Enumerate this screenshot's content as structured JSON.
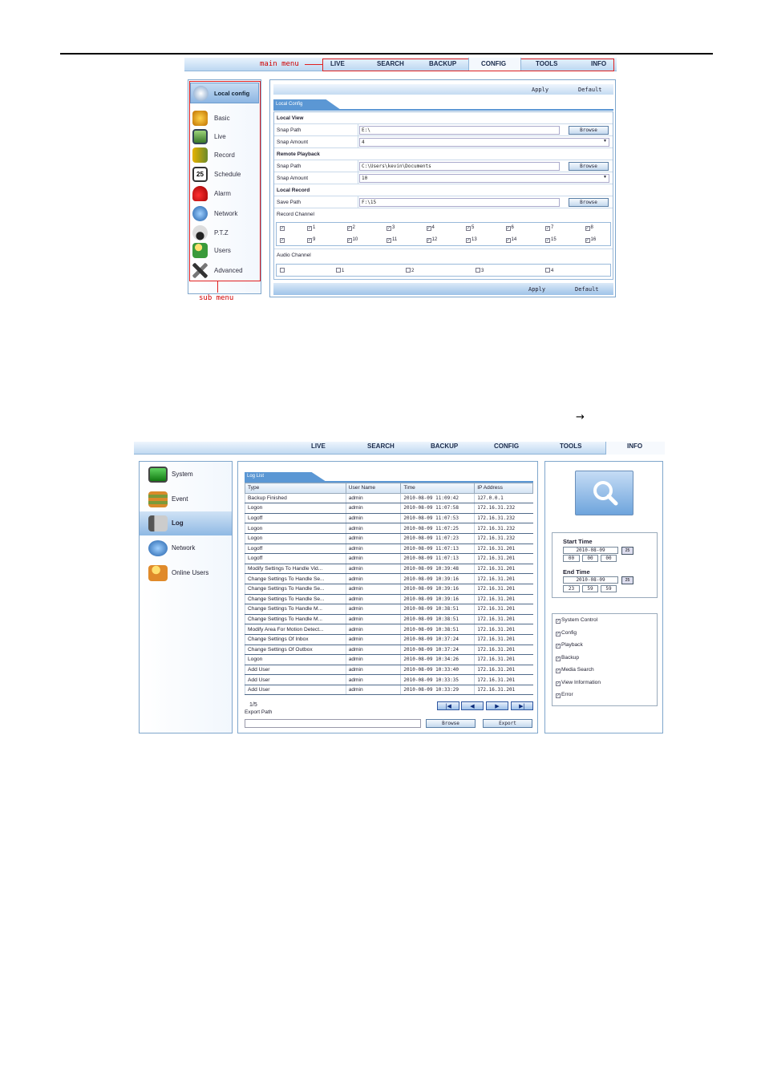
{
  "shot1": {
    "annotations": {
      "main_menu": "main menu",
      "sub_menu": "sub menu"
    },
    "menu": [
      "LIVE",
      "SEARCH",
      "BACKUP",
      "CONFIG",
      "TOOLS",
      "INFO"
    ],
    "sidebar": {
      "header": "Local config",
      "items": [
        {
          "label": "Basic",
          "icon": "basic-icon"
        },
        {
          "label": "Live",
          "icon": "live-icon"
        },
        {
          "label": "Record",
          "icon": "record-icon"
        },
        {
          "label": "Schedule",
          "icon": "schedule-icon"
        },
        {
          "label": "Alarm",
          "icon": "alarm-icon"
        },
        {
          "label": "Network",
          "icon": "network-icon"
        },
        {
          "label": "P.T.Z",
          "icon": "ptz-icon"
        },
        {
          "label": "Users",
          "icon": "users-icon"
        },
        {
          "label": "Advanced",
          "icon": "advanced-icon"
        }
      ]
    },
    "schedule_day": "25",
    "apply": "Apply",
    "default": "Default",
    "tab": "Local Config",
    "local_view": {
      "title": "Local View",
      "snap_path_label": "Snap Path",
      "snap_path": "E:\\",
      "snap_amount_label": "Snap Amount",
      "snap_amount": "4"
    },
    "remote_playback": {
      "title": "Remote Playback",
      "snap_path_label": "Snap Path",
      "snap_path": "C:\\Users\\kevin\\Documents",
      "snap_amount_label": "Snap Amount",
      "snap_amount": "10"
    },
    "local_record": {
      "title": "Local Record",
      "save_path_label": "Save Path",
      "save_path": "F:\\15",
      "record_channel_label": "Record Channel",
      "audio_channel_label": "Audio Channel"
    },
    "browse": "Browse",
    "record_channels": [
      "1",
      "2",
      "3",
      "4",
      "5",
      "6",
      "7",
      "8",
      "9",
      "10",
      "11",
      "12",
      "13",
      "14",
      "15",
      "16"
    ],
    "audio_channels": [
      "1",
      "2",
      "3",
      "4"
    ]
  },
  "arrow": "→",
  "shot2": {
    "menu": [
      "LIVE",
      "SEARCH",
      "BACKUP",
      "CONFIG",
      "TOOLS",
      "INFO"
    ],
    "sidebar": [
      {
        "label": "System",
        "icon": "system-icon"
      },
      {
        "label": "Event",
        "icon": "event-icon"
      },
      {
        "label": "Log",
        "icon": "log-icon"
      },
      {
        "label": "Network",
        "icon": "network-icon"
      },
      {
        "label": "Online Users",
        "icon": "online-users-icon"
      }
    ],
    "tab": "Log List",
    "columns": [
      "Type",
      "User Name",
      "Time",
      "IP Address"
    ],
    "rows": [
      [
        "Backup Finished",
        "admin",
        "2010-08-09 11:09:42",
        "127.0.0.1"
      ],
      [
        "Logon",
        "admin",
        "2010-08-09 11:07:58",
        "172.16.31.232"
      ],
      [
        "Logoff",
        "admin",
        "2010-08-09 11:07:53",
        "172.16.31.232"
      ],
      [
        "Logon",
        "admin",
        "2010-08-09 11:07:25",
        "172.16.31.232"
      ],
      [
        "Logon",
        "admin",
        "2010-08-09 11:07:23",
        "172.16.31.232"
      ],
      [
        "Logoff",
        "admin",
        "2010-08-09 11:07:13",
        "172.16.31.201"
      ],
      [
        "Logoff",
        "admin",
        "2010-08-09 11:07:13",
        "172.16.31.201"
      ],
      [
        "Modify Settings To Handle Vid...",
        "admin",
        "2010-08-09 10:39:48",
        "172.16.31.201"
      ],
      [
        "Change Settings To Handle Se...",
        "admin",
        "2010-08-09 10:39:16",
        "172.16.31.201"
      ],
      [
        "Change Settings To Handle Se...",
        "admin",
        "2010-08-09 10:39:16",
        "172.16.31.201"
      ],
      [
        "Change Settings To Handle Se...",
        "admin",
        "2010-08-09 10:39:16",
        "172.16.31.201"
      ],
      [
        "Change Settings To Handle M...",
        "admin",
        "2010-08-09 10:38:51",
        "172.16.31.201"
      ],
      [
        "Change Settings To Handle M...",
        "admin",
        "2010-08-09 10:38:51",
        "172.16.31.201"
      ],
      [
        "Modify Area For Motion Detect...",
        "admin",
        "2010-08-09 10:38:51",
        "172.16.31.201"
      ],
      [
        "Change Settings Of Inbox",
        "admin",
        "2010-08-09 10:37:24",
        "172.16.31.201"
      ],
      [
        "Change Settings Of Outbox",
        "admin",
        "2010-08-09 10:37:24",
        "172.16.31.201"
      ],
      [
        "Logon",
        "admin",
        "2010-08-09 10:34:26",
        "172.16.31.201"
      ],
      [
        "Add User",
        "admin",
        "2010-08-09 10:33:40",
        "172.16.31.201"
      ],
      [
        "Add User",
        "admin",
        "2010-08-09 10:33:35",
        "172.16.31.201"
      ],
      [
        "Add User",
        "admin",
        "2010-08-09 10:33:29",
        "172.16.31.201"
      ]
    ],
    "page": "1/5",
    "export_path_label": "Export Path",
    "browse": "Browse",
    "export": "Export",
    "start_time": {
      "label": "Start Time",
      "date": "2010-08-09",
      "h": "00",
      "m": "00",
      "s": "00"
    },
    "end_time": {
      "label": "End Time",
      "date": "2010-08-09",
      "h": "23",
      "m": "59",
      "s": "59"
    },
    "cal_day": "25",
    "filters": [
      "System Control",
      "Config",
      "Playback",
      "Backup",
      "Media Search",
      "View Information",
      "Error"
    ]
  }
}
